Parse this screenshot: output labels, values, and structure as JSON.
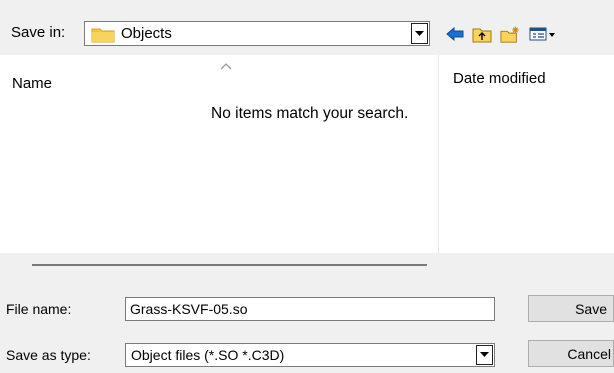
{
  "toolbar": {
    "save_in_label": "Save in:",
    "save_in_value": "Objects",
    "icons": [
      "back-arrow-icon",
      "up-folder-icon",
      "new-folder-icon",
      "view-menu-icon"
    ]
  },
  "list": {
    "columns": [
      "Name",
      "Date modified"
    ],
    "empty_message": "No items match your search."
  },
  "form": {
    "file_name_label": "File name:",
    "file_name_value": "Grass-KSVF-05.so",
    "save_type_label": "Save as type:",
    "save_type_value": "Object files (*.SO *.C3D)"
  },
  "buttons": {
    "save_label": "Save",
    "cancel_label": "Cancel"
  },
  "colors": {
    "folder": "#f5c242",
    "accent_blue": "#1b6fd1",
    "window_bg": "#f0f0f0"
  }
}
